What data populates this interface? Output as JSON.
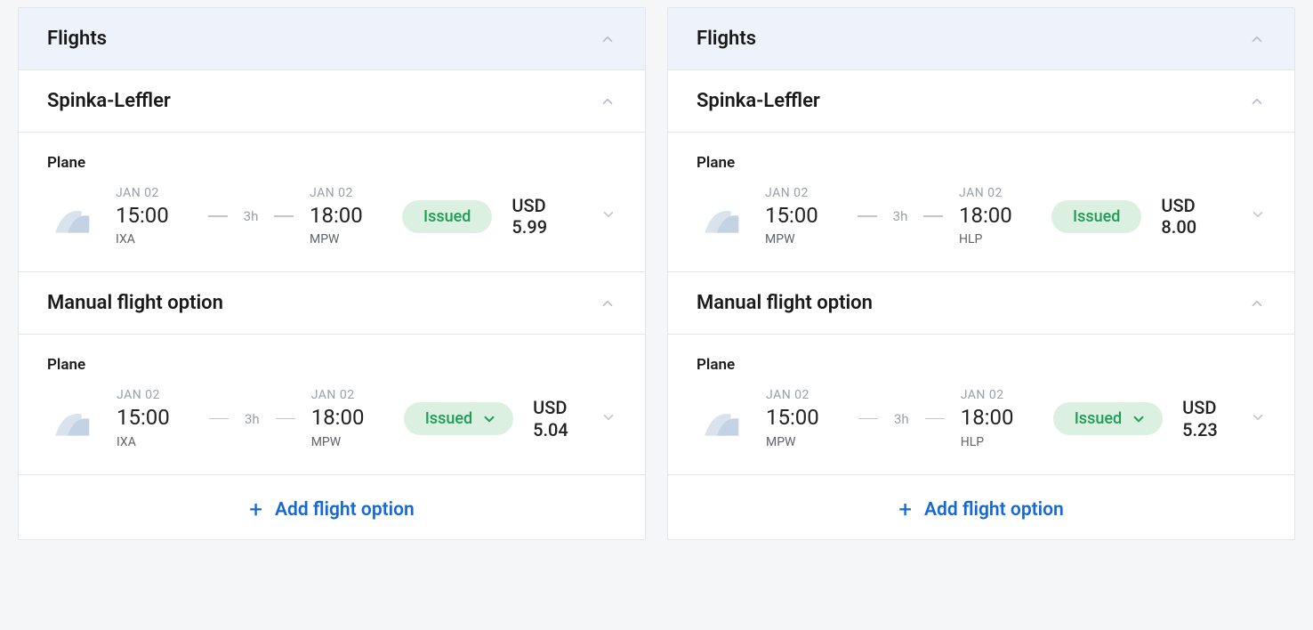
{
  "labels": {
    "flights_header": "Flights",
    "add_flight_option": "Add flight option",
    "manual_option": "Manual flight option"
  },
  "panels": [
    {
      "provider": "Spinka-Leffler",
      "segments": [
        {
          "mode": "Plane",
          "dep_date": "JAN 02",
          "dep_time": "15:00",
          "dep_code": "IXA",
          "duration": "3h",
          "arr_date": "JAN 02",
          "arr_time": "18:00",
          "arr_code": "MPW",
          "status": "Issued",
          "status_dropdown": false,
          "price_currency": "USD",
          "price_amount": "5.99"
        },
        {
          "section_title": "Manual flight option",
          "mode": "Plane",
          "dep_date": "JAN 02",
          "dep_time": "15:00",
          "dep_code": "IXA",
          "duration": "3h",
          "arr_date": "JAN 02",
          "arr_time": "18:00",
          "arr_code": "MPW",
          "status": "Issued",
          "status_dropdown": true,
          "price_currency": "USD",
          "price_amount": "5.04"
        }
      ]
    },
    {
      "provider": "Spinka-Leffler",
      "segments": [
        {
          "mode": "Plane",
          "dep_date": "JAN 02",
          "dep_time": "15:00",
          "dep_code": "MPW",
          "duration": "3h",
          "arr_date": "JAN 02",
          "arr_time": "18:00",
          "arr_code": "HLP",
          "status": "Issued",
          "status_dropdown": false,
          "price_currency": "USD",
          "price_amount": "8.00"
        },
        {
          "section_title": "Manual flight option",
          "mode": "Plane",
          "dep_date": "JAN 02",
          "dep_time": "15:00",
          "dep_code": "MPW",
          "duration": "3h",
          "arr_date": "JAN 02",
          "arr_time": "18:00",
          "arr_code": "HLP",
          "status": "Issued",
          "status_dropdown": true,
          "price_currency": "USD",
          "price_amount": "5.23"
        }
      ]
    }
  ]
}
